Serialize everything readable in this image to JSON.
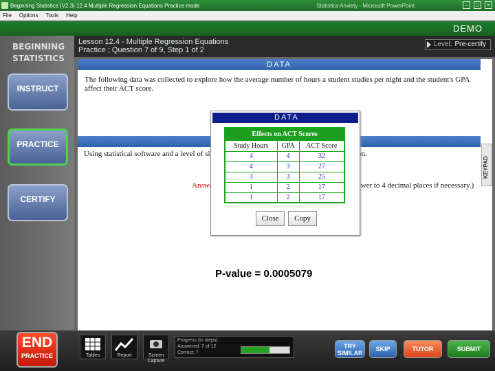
{
  "window": {
    "title": "Beginning Statistics (V2.3)    12.4 Multiple Regression Equations    Practice mode",
    "title_right": "Statistics Anxiety - Microsoft PowerPoint",
    "controls": [
      "–",
      "□",
      "×"
    ]
  },
  "menu": [
    "File",
    "Options",
    "Tools",
    "Help"
  ],
  "demo_label": "DEMO",
  "sidebar": {
    "brand_line1": "BEGINNING",
    "brand_line2": "STATISTICS",
    "buttons": [
      "INSTRUCT",
      "PRACTICE",
      "CERTIFY"
    ]
  },
  "header": {
    "lesson": "Lesson 12.4 - Multiple Regression Equations",
    "practice": "Practice ; Question 7 of 9, Step 1 of 2",
    "level_label": "Level:",
    "level_value": "Pre-certify"
  },
  "section_title": "DATA",
  "question_text": "The following data was collected to explore how the average number of hours a student studies per night and the student's GPA affect their ACT score.",
  "partial_text_1": "Using statistical software and a level of signific",
  "partial_text_1_right": "ion.",
  "partial_answer_label": "Answe",
  "partial_text_2_right": "answer to 4 decimal places if necessary.)",
  "keypad_label": "KEYPAD",
  "dialog": {
    "title": "DATA",
    "table": {
      "caption": "Effects on ACT Scores",
      "headers": [
        "Study Hours",
        "GPA",
        "ACT Score"
      ],
      "rows": [
        [
          "4",
          "4",
          "32"
        ],
        [
          "4",
          "3",
          "27"
        ],
        [
          "3",
          "3",
          "25"
        ],
        [
          "1",
          "2",
          "17"
        ],
        [
          "1",
          "2",
          "17"
        ]
      ]
    },
    "close_label": "Close",
    "copy_label": "Copy"
  },
  "pvalue_text": "P-value = 0.0005079",
  "bottom": {
    "end_big": "END",
    "end_small": "PRACTICE",
    "tools": [
      "Tables",
      "Report",
      "Screen Capture"
    ],
    "progress": {
      "title": "Progress (in steps)",
      "answered": "Answered:  7 of 12",
      "correct": "Correct:    7",
      "fraction": 0.583
    },
    "actions": [
      "TRY SIMILAR",
      "SKIP",
      "TUTOR",
      "SUBMIT"
    ]
  },
  "colors": {
    "title_green": "#1f6e28",
    "data_bar_blue": "#2f62ad",
    "dialog_bar": "#0d1d8c",
    "table_green": "#1aa61a",
    "answer_red": "#d40000"
  }
}
